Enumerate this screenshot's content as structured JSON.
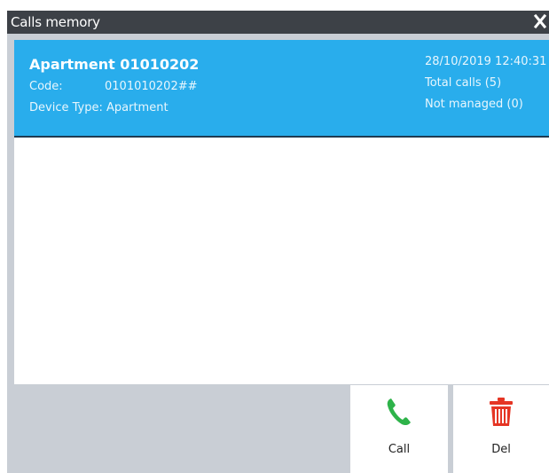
{
  "window": {
    "title": "Calls memory"
  },
  "entry": {
    "name": "Apartment 01010202",
    "code_label": "Code:",
    "code_value": "0101010202##",
    "device_label": "Device Type:",
    "device_value": "Apartment",
    "datetime": "28/10/2019 12:40:31",
    "total_calls": "Total calls (5)",
    "not_managed": "Not managed (0)"
  },
  "actions": {
    "call_label": "Call",
    "del_label": "Del"
  },
  "colors": {
    "titlebar": "#3d4147",
    "selected_row": "#29adec",
    "call_icon": "#2eb34a",
    "delete_icon": "#e53524",
    "frame_background": "#c9ced5"
  },
  "icons": {
    "close": "close-icon",
    "call": "phone-icon",
    "delete": "trash-icon"
  }
}
